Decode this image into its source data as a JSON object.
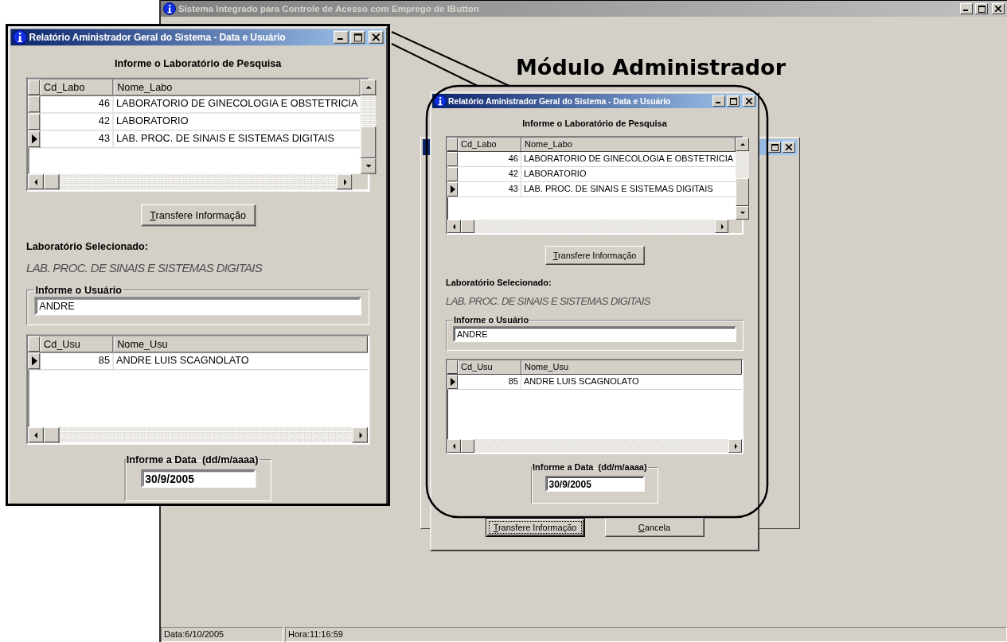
{
  "main_window": {
    "title": "Sistema Integrado para Controle de Acesso com Emprego de IButton"
  },
  "module_title": "Módulo Administrador",
  "dialogs": [
    {
      "title": "Relatório Aministrador Geral do Sistema - Data e Usuário",
      "heading": "Informe o Laboratório de Pesquisa",
      "lab_table": {
        "columns": [
          "Cd_Labo",
          "Nome_Labo"
        ],
        "rows": [
          {
            "code": "46",
            "name": "LABORATORIO DE GINECOLOGIA E OBSTETRICIA",
            "selected": false
          },
          {
            "code": "42",
            "name": "LABORATORIO",
            "selected": false
          },
          {
            "code": "43",
            "name": "LAB. PROC. DE SINAIS E SISTEMAS DIGITAIS",
            "selected": true
          }
        ]
      },
      "transfer_button": "Transfere Informação",
      "selected_label": "Laboratório Selecionado:",
      "selected_value": "LAB. PROC. DE SINAIS E SISTEMAS DIGITAIS",
      "user_group": {
        "legend": "Informe o Usuário",
        "value": "ANDRE"
      },
      "user_table": {
        "columns": [
          "Cd_Usu",
          "Nome_Usu"
        ],
        "rows": [
          {
            "code": "85",
            "name": "ANDRE LUIS SCAGNOLATO",
            "selected": true
          }
        ]
      },
      "date_group": {
        "legend": "Informe a Data  (dd/m/aaaa)",
        "value": "30/9/2005"
      }
    },
    {
      "title": "Relatório Aministrador Geral do Sistema - Data e Usuário",
      "heading": "Informe o Laboratório de Pesquisa",
      "lab_table": {
        "columns": [
          "Cd_Labo",
          "Nome_Labo"
        ],
        "rows": [
          {
            "code": "46",
            "name": "LABORATORIO DE GINECOLOGIA E OBSTETRICIA",
            "selected": false
          },
          {
            "code": "42",
            "name": "LABORATORIO",
            "selected": false
          },
          {
            "code": "43",
            "name": "LAB. PROC. DE SINAIS E SISTEMAS DIGITAIS",
            "selected": true
          }
        ]
      },
      "transfer_button": "Transfere Informação",
      "selected_label": "Laboratório Selecionado:",
      "selected_value": "LAB. PROC. DE SINAIS E SISTEMAS DIGITAIS",
      "user_group": {
        "legend": "Informe o Usuário",
        "value": "ANDRE"
      },
      "user_table": {
        "columns": [
          "Cd_Usu",
          "Nome_Usu"
        ],
        "rows": [
          {
            "code": "85",
            "name": "ANDRE LUIS SCAGNOLATO",
            "selected": true
          }
        ]
      },
      "date_group": {
        "legend": "Informe a Data  (dd/m/aaaa)",
        "value": "30/9/2005"
      },
      "buttons": [
        {
          "label": "Transfere Informação",
          "focused": true
        },
        {
          "label": "Cancela",
          "focused": false
        }
      ]
    }
  ],
  "status_bar": [
    "Data:6/10/2005",
    "Hora:11:16:59"
  ]
}
